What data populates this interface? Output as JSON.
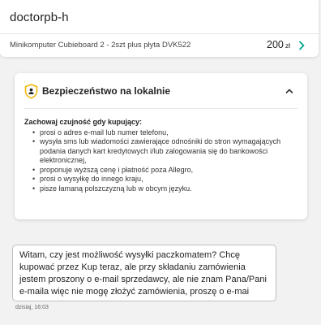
{
  "header": {
    "seller_name": "doctorpb-h",
    "offer_title": "Minikomputer Cubieboard 2 - 2szt plus płyta DVK522",
    "price_value": "200",
    "price_currency": "zł",
    "chevron_icon": "chevron-right-icon"
  },
  "security": {
    "title": "Bezpieczeństwo na lokalnie",
    "icon": "shield-user-icon",
    "collapse_icon": "chevron-up-icon",
    "lead": "Zachowaj czujność gdy kupujący:",
    "items": [
      "prosi o adres e-mail lub numer telefonu,",
      "wysyła sms lub wiadomości zawierające odnośniki do stron wymagających podania danych kart kredytowych i/lub zalogowania się do bankowości elektronicznej,",
      "proponuje wyższą cenę i płatność poza Allegro,",
      "prosi o wysyłkę do innego kraju,",
      "pisze łamaną polszczyzną lub w obcym języku."
    ]
  },
  "message": {
    "text": "Witam, czy jest możliwość wysyłki paczkomatem? Chcę kupować przez Kup teraz, ale przy składaniu zamówienia jestem proszony o e-mail sprzedawcy, ale nie znam Pana/Pani e-maila więc nie mogę złożyć zamówienia, proszę o e-mai",
    "timestamp": "dzisiaj, 16:03"
  },
  "colors": {
    "accent": "#00a790",
    "shield": "#f2b705",
    "background": "#f2f2f2"
  }
}
